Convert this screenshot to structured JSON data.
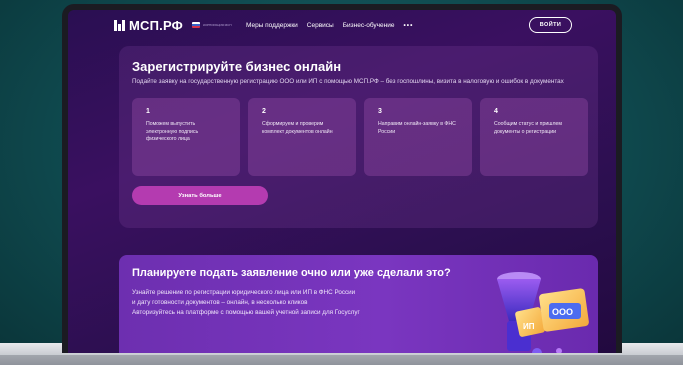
{
  "header": {
    "logo_text": "МСП.РФ",
    "corp_logo_text": "КОРПОРАЦИЯ МСП",
    "nav": [
      "Меры поддержки",
      "Сервисы",
      "Бизнес-обучение"
    ],
    "more_dots": "•••",
    "login_label": "ВОЙТИ"
  },
  "registration": {
    "title": "Зарегистрируйте бизнес онлайн",
    "subtitle": "Подайте заявку на государственную регистрацию ООО или ИП с помощью МСП.РФ – без госпошлины,  визита в налоговую и ошибок в документах",
    "steps": [
      {
        "num": "1",
        "text": "Поможем выпустить электронную подпись физического лица"
      },
      {
        "num": "2",
        "text": "Сформируем  и проверим комплект документов онлайн"
      },
      {
        "num": "3",
        "text": "Направим онлайн-заявку в ФНС России"
      },
      {
        "num": "4",
        "text": "Сообщим статус и пришлем документы о регистрации"
      }
    ],
    "button_label": "Узнать больше"
  },
  "promo": {
    "title": "Планируете подать заявление очно или уже сделали это?",
    "lines": [
      "Узнайте решение по регистрации юридического лица или ИП в ФНС России",
      "и дату готовности документов – онлайн, в несколько кликов",
      "Авторизуйтесь на платформе с помощью вашей учетной записи для Госуслуг"
    ],
    "badge_ip": "ИП",
    "badge_ooo": "ООО"
  }
}
